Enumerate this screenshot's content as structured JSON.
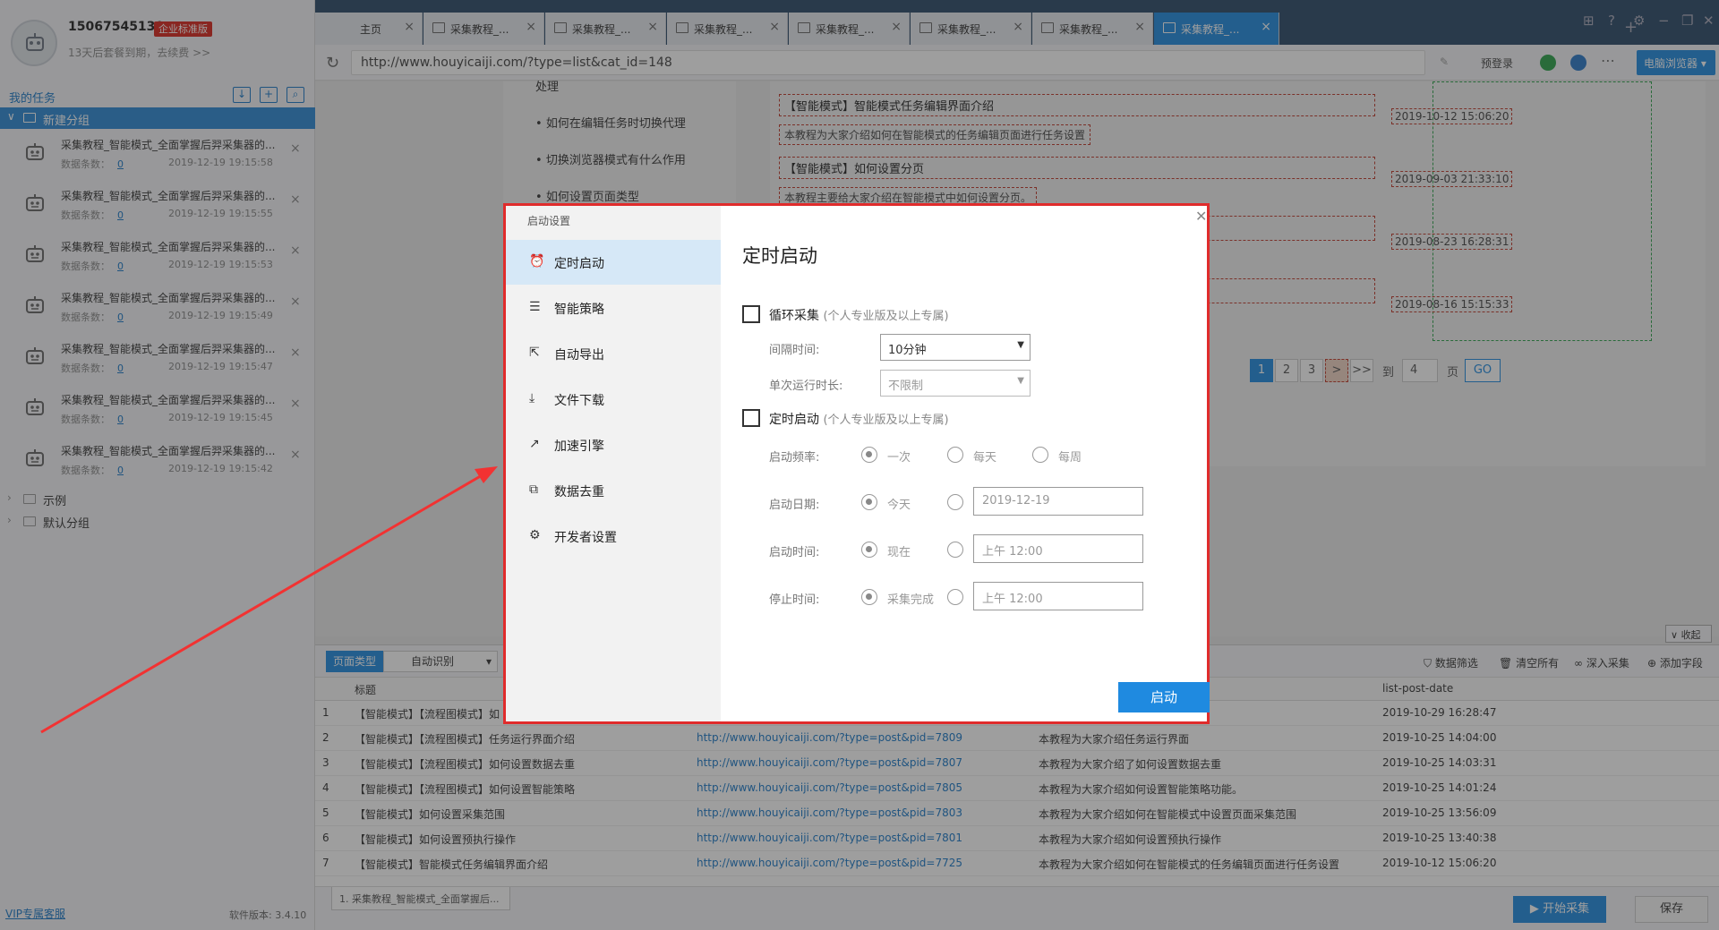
{
  "user": {
    "phone": "15067545130",
    "badge": "企业标准版",
    "expire": "13天后套餐到期，去续费 >>"
  },
  "sidebar": {
    "my_tasks": "我的任务",
    "group": "新建分组",
    "tasks": [
      {
        "title": "采集教程_智能模式_全面掌握后羿采集器的...",
        "count_label": "数据条数：",
        "count": "0",
        "date": "2019-12-19 19:15:58"
      },
      {
        "title": "采集教程_智能模式_全面掌握后羿采集器的...",
        "count_label": "数据条数：",
        "count": "0",
        "date": "2019-12-19 19:15:55"
      },
      {
        "title": "采集教程_智能模式_全面掌握后羿采集器的...",
        "count_label": "数据条数：",
        "count": "0",
        "date": "2019-12-19 19:15:53"
      },
      {
        "title": "采集教程_智能模式_全面掌握后羿采集器的...",
        "count_label": "数据条数：",
        "count": "0",
        "date": "2019-12-19 19:15:49"
      },
      {
        "title": "采集教程_智能模式_全面掌握后羿采集器的...",
        "count_label": "数据条数：",
        "count": "0",
        "date": "2019-12-19 19:15:47"
      },
      {
        "title": "采集教程_智能模式_全面掌握后羿采集器的...",
        "count_label": "数据条数：",
        "count": "0",
        "date": "2019-12-19 19:15:45"
      },
      {
        "title": "采集教程_智能模式_全面掌握后羿采集器的...",
        "count_label": "数据条数：",
        "count": "0",
        "date": "2019-12-19 19:15:42"
      }
    ],
    "folders": [
      "示例",
      "默认分组"
    ],
    "vip": "VIP专属客服",
    "version": "软件版本: 3.4.10"
  },
  "tabs": [
    "主页",
    "采集教程_...",
    "采集教程_...",
    "采集教程_...",
    "采集教程_...",
    "采集教程_...",
    "采集教程_...",
    "采集教程_..."
  ],
  "address": {
    "url": "http://www.houyicaiji.com/?type=list&cat_id=148",
    "login": "预登录",
    "browser": "电脑浏览器"
  },
  "web": {
    "left_items": [
      "处理",
      "如何在编辑任务时切换代理",
      "切换浏览器模式有什么作用",
      "如何设置页面类型"
    ],
    "articles": [
      {
        "title": "【智能模式】智能模式任务编辑界面介绍",
        "desc": "本教程为大家介绍如何在智能模式的任务编辑页面进行任务设置",
        "date": "2019-10-12 15:06:20"
      },
      {
        "title": "【智能模式】如何设置分页",
        "desc": "本教程主要给大家介绍在智能模式中如何设置分页。",
        "date": "2019-09-03 21:33:10"
      },
      {
        "title": "",
        "desc": "",
        "date": "2019-08-23 16:28:31"
      },
      {
        "title": "",
        "desc": "",
        "date": "2019-08-16 15:15:33"
      }
    ],
    "pages": [
      "1",
      "2",
      "3",
      ">",
      ">>"
    ],
    "to": "到",
    "jump": "4",
    "page_unit": "页",
    "go": "GO",
    "collapse": "收起"
  },
  "panel": {
    "page_type": "页面类型",
    "auto": "自动识别",
    "tools": [
      "数据筛选",
      "清空所有",
      "深入采集",
      "添加字段"
    ],
    "headers": [
      "标题",
      "list-post-date"
    ],
    "rows": [
      {
        "n": "1",
        "t": "【智能模式】【流程图模式】如",
        "u": "",
        "d": "",
        "dt": "2019-10-29 16:28:47"
      },
      {
        "n": "2",
        "t": "【智能模式】【流程图模式】任务运行界面介绍",
        "u": "http://www.houyicaiji.com/?type=post&pid=7809",
        "d": "本教程为大家介绍任务运行界面",
        "dt": "2019-10-25 14:04:00"
      },
      {
        "n": "3",
        "t": "【智能模式】【流程图模式】如何设置数据去重",
        "u": "http://www.houyicaiji.com/?type=post&pid=7807",
        "d": "本教程为大家介绍了如何设置数据去重",
        "dt": "2019-10-25 14:03:31"
      },
      {
        "n": "4",
        "t": "【智能模式】【流程图模式】如何设置智能策略",
        "u": "http://www.houyicaiji.com/?type=post&pid=7805",
        "d": "本教程为大家介绍如何设置智能策略功能。",
        "dt": "2019-10-25 14:01:24"
      },
      {
        "n": "5",
        "t": "【智能模式】如何设置采集范围",
        "u": "http://www.houyicaiji.com/?type=post&pid=7803",
        "d": "本教程为大家介绍如何在智能模式中设置页面采集范围",
        "dt": "2019-10-25 13:56:09"
      },
      {
        "n": "6",
        "t": "【智能模式】如何设置预执行操作",
        "u": "http://www.houyicaiji.com/?type=post&pid=7801",
        "d": "本教程为大家介绍如何设置预执行操作",
        "dt": "2019-10-25 13:40:38"
      },
      {
        "n": "7",
        "t": "【智能模式】智能模式任务编辑界面介绍",
        "u": "http://www.houyicaiji.com/?type=post&pid=7725",
        "d": "本教程为大家介绍如何在智能模式的任务编辑页面进行任务设置",
        "dt": "2019-10-12 15:06:20"
      }
    ]
  },
  "footer": {
    "tab": "1. 采集教程_智能模式_全面掌握后...",
    "start": "开始采集",
    "save": "保存"
  },
  "dialog": {
    "title": "启动设置",
    "nav": [
      "定时启动",
      "智能策略",
      "自动导出",
      "文件下载",
      "加速引擎",
      "数据去重",
      "开发者设置"
    ],
    "heading": "定时启动",
    "loop": {
      "label": "循环采集",
      "note": "(个人专业版及以上专属)"
    },
    "interval_label": "间隔时间:",
    "interval_value": "10分钟",
    "duration_label": "单次运行时长:",
    "duration_value": "不限制",
    "timed": {
      "label": "定时启动",
      "note": "(个人专业版及以上专属)"
    },
    "freq_label": "启动频率:",
    "freq": [
      "一次",
      "每天",
      "每周"
    ],
    "date_label": "启动日期:",
    "date_opt": "今天",
    "date_value": "2019-12-19",
    "time_label": "启动时间:",
    "time_opt": "现在",
    "time_value": "上午 12:00",
    "stop_label": "停止时间:",
    "stop_opt": "采集完成",
    "stop_value": "上午 12:00",
    "start": "启动"
  }
}
